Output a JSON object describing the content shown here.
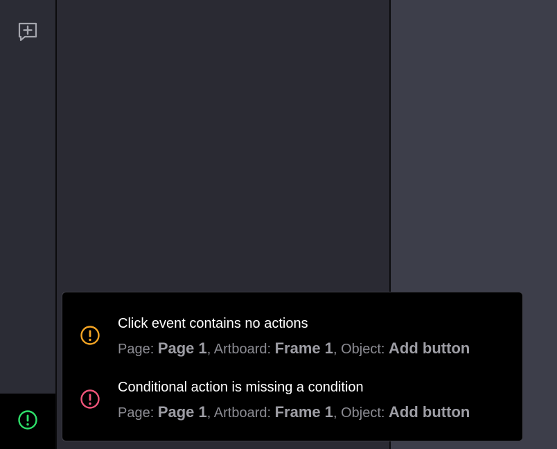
{
  "left_rail": {
    "comment_icon": "comment-add-icon",
    "status_icon": "exclamation-circle-icon",
    "status_color": "#2ee06a"
  },
  "problems": [
    {
      "severity": "warning",
      "color": "#f5a524",
      "icon": "exclamation-circle-icon",
      "title": "Click event contains no actions",
      "page_label": "Page: ",
      "page_value": "Page 1",
      "artboard_label": ", Artboard: ",
      "artboard_value": "Frame 1",
      "object_label": ", Object: ",
      "object_value": "Add button"
    },
    {
      "severity": "error",
      "color": "#f0557a",
      "icon": "exclamation-circle-icon",
      "title": "Conditional action is missing a condition",
      "page_label": "Page: ",
      "page_value": "Page 1",
      "artboard_label": ", Artboard: ",
      "artboard_value": "Frame 1",
      "object_label": ", Object: ",
      "object_value": "Add button"
    }
  ]
}
